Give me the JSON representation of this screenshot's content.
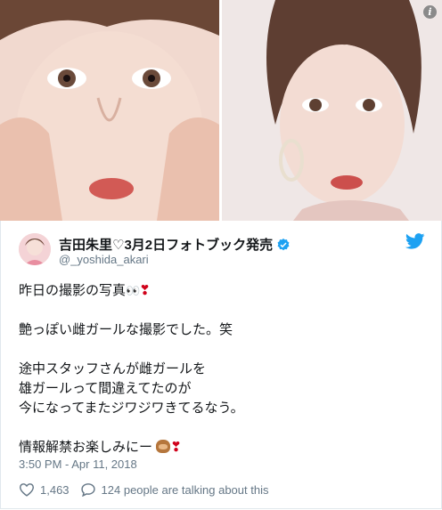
{
  "header": {
    "name": "吉田朱里♡3月2日フォトブック発売",
    "handle": "@_yoshida_akari"
  },
  "icons": {
    "info": "info-icon",
    "verified": "verified-badge-icon",
    "twitter": "twitter-bird-icon",
    "like": "heart-outline-icon",
    "reply": "speech-bubble-icon",
    "brand_color": "#1da1f2"
  },
  "tweet": {
    "line1": "昨日の撮影の写真",
    "line1_emoji": "👀❣️",
    "line2": "艶っぽい雌ガールな撮影でした。笑",
    "line3": "途中スタッフさんが雌ガールを",
    "line4": "雄ガールって間違えてたのが",
    "line5": "今になってまたジワジワきてるなう。",
    "line6": "情報解禁お楽しみにー",
    "line6_emoji": "🙈❣️",
    "eyes": "👀",
    "heart_ex": "❣",
    "info_glyph": "i"
  },
  "meta": {
    "timestamp": "3:50 PM - Apr 11, 2018",
    "likes": "1,463",
    "talking": "124 people are talking about this"
  }
}
